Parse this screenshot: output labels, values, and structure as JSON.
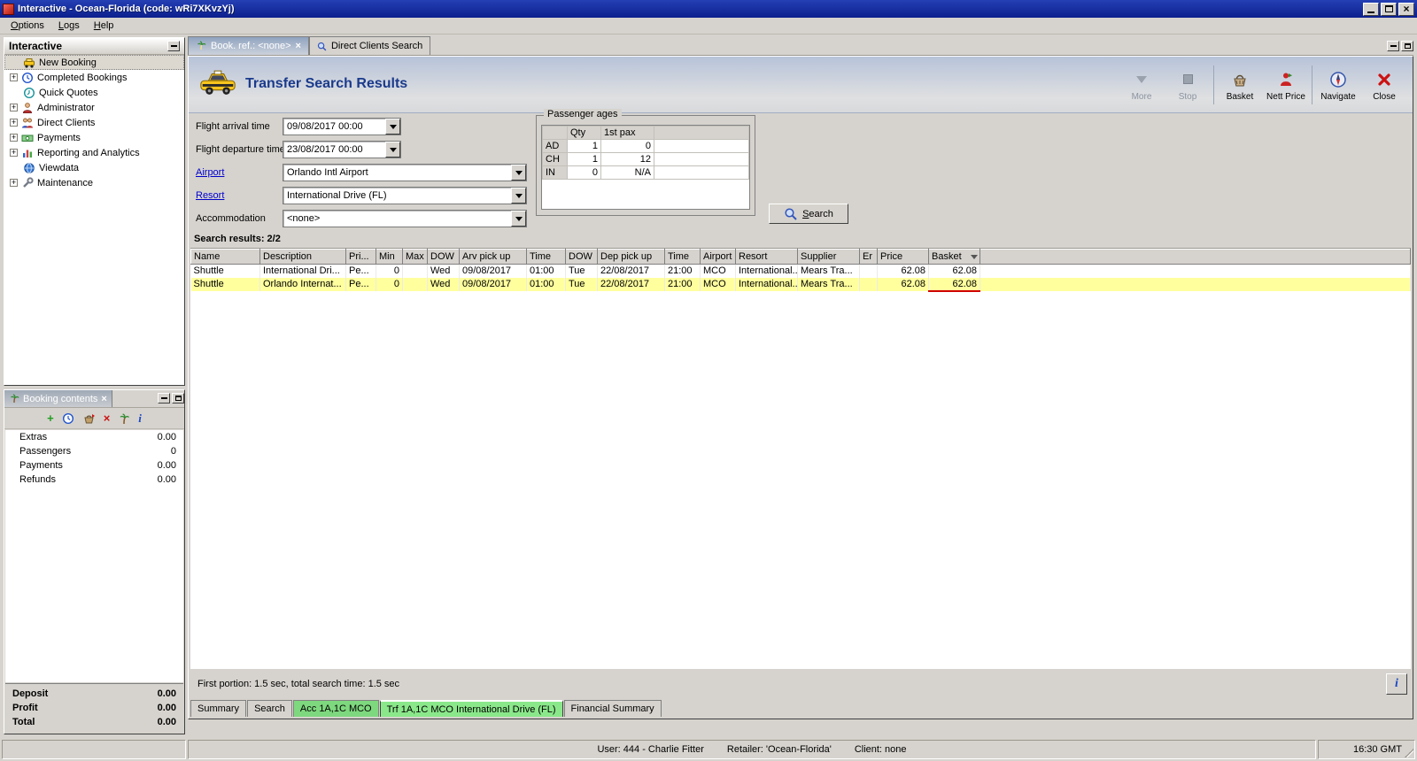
{
  "window": {
    "title": "Interactive - Ocean-Florida (code: wRi7XKvzYj)",
    "menu": {
      "options": "Options",
      "logs": "Logs",
      "help": "Help"
    }
  },
  "sidebar": {
    "title": "Interactive",
    "items": [
      {
        "label": "New Booking"
      },
      {
        "label": "Completed Bookings"
      },
      {
        "label": "Quick Quotes"
      },
      {
        "label": "Administrator"
      },
      {
        "label": "Direct Clients"
      },
      {
        "label": "Payments"
      },
      {
        "label": "Reporting and Analytics"
      },
      {
        "label": "Viewdata"
      },
      {
        "label": "Maintenance"
      }
    ]
  },
  "booking_contents": {
    "title": "Booking contents",
    "items": [
      {
        "label": "Extras",
        "value": "0.00"
      },
      {
        "label": "Passengers",
        "value": "0"
      },
      {
        "label": "Payments",
        "value": "0.00"
      },
      {
        "label": "Refunds",
        "value": "0.00"
      }
    ],
    "totals": [
      {
        "label": "Deposit",
        "value": "0.00"
      },
      {
        "label": "Profit",
        "value": "0.00"
      },
      {
        "label": "Total",
        "value": "0.00"
      }
    ]
  },
  "tabs": {
    "booking": "Book. ref.: <none>",
    "direct_clients": "Direct Clients Search"
  },
  "main": {
    "title": "Transfer Search Results",
    "toolbar": {
      "more": "More",
      "stop": "Stop",
      "basket": "Basket",
      "nett_price": "Nett Price",
      "navigate": "Navigate",
      "close": "Close"
    },
    "form": {
      "flight_arrival": {
        "label": "Flight arrival time",
        "value": "09/08/2017 00:00"
      },
      "flight_departure": {
        "label": "Flight departure time",
        "value": "23/08/2017 00:00"
      },
      "airport": {
        "label": "Airport",
        "value": "Orlando Intl Airport"
      },
      "resort": {
        "label": "Resort",
        "value": "International Drive (FL)"
      },
      "accommodation": {
        "label": "Accommodation",
        "value": "<none>"
      }
    },
    "passenger_ages": {
      "title": "Passenger ages",
      "col_qty": "Qty",
      "col_first_pax": "1st pax",
      "rows": [
        {
          "type": "AD",
          "qty": "1",
          "first_pax": "0"
        },
        {
          "type": "CH",
          "qty": "1",
          "first_pax": "12"
        },
        {
          "type": "IN",
          "qty": "0",
          "first_pax": "N/A"
        }
      ]
    },
    "search_button": "Search",
    "results_label": "Search results: 2/2",
    "results": {
      "columns": [
        "Name",
        "Description",
        "Pri...",
        "Min",
        "Max",
        "DOW",
        "Arv pick up",
        "Time",
        "DOW",
        "Dep pick up",
        "Time",
        "Airport",
        "Resort",
        "Supplier",
        "Er",
        "Price",
        "Basket"
      ],
      "rows": [
        {
          "cells": [
            "Shuttle",
            "International Dri...",
            "Pe...",
            "0",
            "",
            "Wed",
            "09/08/2017",
            "01:00",
            "Tue",
            "22/08/2017",
            "21:00",
            "MCO",
            "International...",
            "Mears Tra...",
            "",
            "62.08",
            "62.08"
          ]
        },
        {
          "cells": [
            "Shuttle",
            "Orlando Internat...",
            "Pe...",
            "0",
            "",
            "Wed",
            "09/08/2017",
            "01:00",
            "Tue",
            "22/08/2017",
            "21:00",
            "MCO",
            "International...",
            "Mears Tra...",
            "",
            "62.08",
            "62.08"
          ]
        }
      ]
    },
    "status_text": "First portion: 1.5 sec, total search time: 1.5 sec",
    "info_button": "i",
    "bottom_tabs": [
      "Summary",
      "Search",
      "Acc 1A,1C MCO",
      "Trf 1A,1C MCO International Drive (FL)",
      "Financial Summary"
    ]
  },
  "statusbar": {
    "user": "User: 444 - Charlie Fitter",
    "retailer": "Retailer: 'Ocean-Florida'",
    "client": "Client: none",
    "time": "16:30 GMT"
  }
}
